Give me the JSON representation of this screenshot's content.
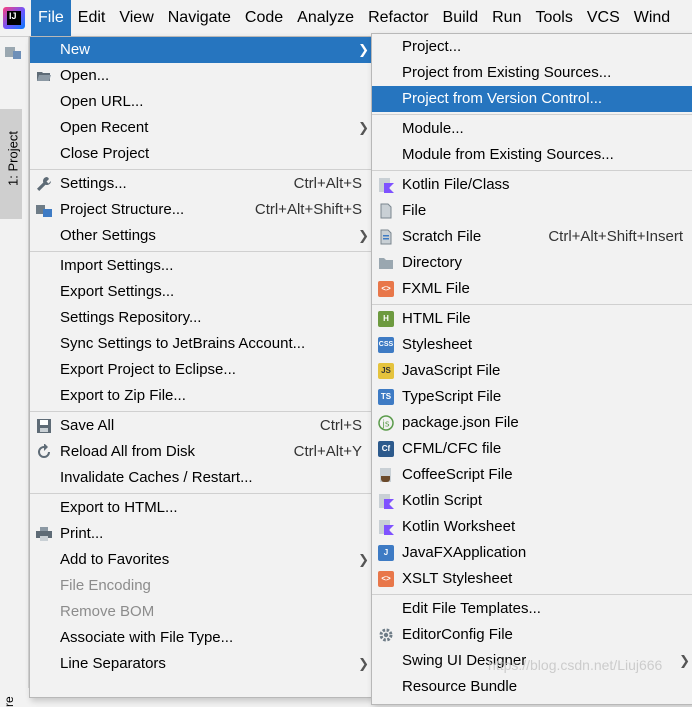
{
  "menubar": {
    "logo_letters": "IJ",
    "items": [
      "File",
      "Edit",
      "View",
      "Navigate",
      "Code",
      "Analyze",
      "Refactor",
      "Build",
      "Run",
      "Tools",
      "VCS",
      "Wind"
    ]
  },
  "left_strip": {
    "project_tab": "1: Project",
    "bottom_label": "re"
  },
  "file_menu": {
    "new": "New",
    "open": "Open...",
    "open_url": "Open URL...",
    "open_recent": "Open Recent",
    "close_project": "Close Project",
    "settings": "Settings...",
    "settings_shortcut": "Ctrl+Alt+S",
    "project_structure": "Project Structure...",
    "project_structure_shortcut": "Ctrl+Alt+Shift+S",
    "other_settings": "Other Settings",
    "import_settings": "Import Settings...",
    "export_settings": "Export Settings...",
    "settings_repository": "Settings Repository...",
    "sync_settings": "Sync Settings to JetBrains Account...",
    "export_eclipse": "Export Project to Eclipse...",
    "export_zip": "Export to Zip File...",
    "save_all": "Save All",
    "save_all_shortcut": "Ctrl+S",
    "reload": "Reload All from Disk",
    "reload_shortcut": "Ctrl+Alt+Y",
    "invalidate": "Invalidate Caches / Restart...",
    "export_html": "Export to HTML...",
    "print": "Print...",
    "add_favorites": "Add to Favorites",
    "file_encoding": "File Encoding",
    "remove_bom": "Remove BOM",
    "associate": "Associate with File Type...",
    "line_separators": "Line Separators"
  },
  "new_menu": {
    "project": "Project...",
    "project_existing": "Project from Existing Sources...",
    "project_vcs": "Project from Version Control...",
    "module": "Module...",
    "module_existing": "Module from Existing Sources...",
    "kotlin_file": "Kotlin File/Class",
    "file": "File",
    "scratch_file": "Scratch File",
    "scratch_shortcut": "Ctrl+Alt+Shift+Insert",
    "directory": "Directory",
    "fxml_file": "FXML File",
    "html_file": "HTML File",
    "stylesheet": "Stylesheet",
    "javascript_file": "JavaScript File",
    "typescript_file": "TypeScript File",
    "package_json": "package.json File",
    "cfml_file": "CFML/CFC file",
    "coffeescript_file": "CoffeeScript File",
    "kotlin_script": "Kotlin Script",
    "kotlin_worksheet": "Kotlin Worksheet",
    "javafx_app": "JavaFXApplication",
    "xslt_stylesheet": "XSLT Stylesheet",
    "edit_templates": "Edit File Templates...",
    "editorconfig": "EditorConfig File",
    "swing_designer": "Swing UI Designer",
    "resource_bundle": "Resource Bundle"
  },
  "icon_badges": {
    "html": "H",
    "css": "CSS",
    "js": "JS",
    "ts": "TS",
    "cf": "Cf",
    "fxml": "<>",
    "xslt": "<>",
    "javafx": "J"
  },
  "watermark": "https://blog.csdn.net/Liuj666",
  "colors": {
    "selection": "#2675bf",
    "menu_bg": "#f2f2f2",
    "disabled_text": "#8c8c8c"
  }
}
